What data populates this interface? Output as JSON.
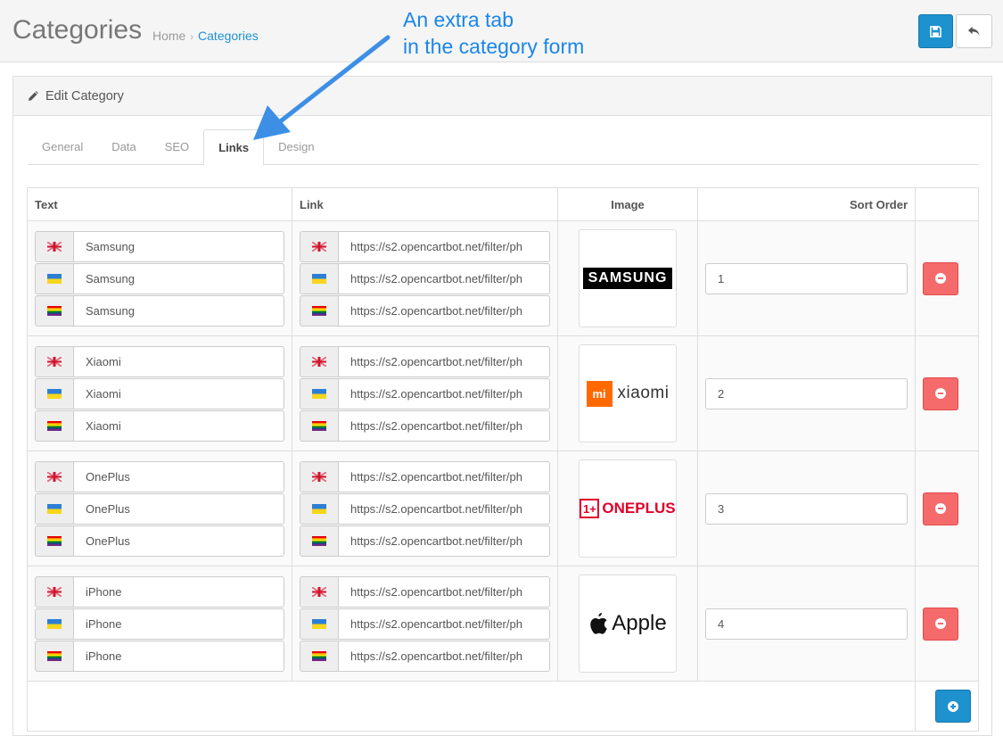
{
  "header": {
    "title": "Categories",
    "breadcrumb": [
      {
        "label": "Home"
      },
      {
        "label": "Categories"
      }
    ],
    "breadcrumb_separator": "›",
    "save_icon": "floppy-disk-icon",
    "back_icon": "reply-arrow-icon"
  },
  "annotation": {
    "text": "An extra tab\nin the category form",
    "color": "#1a86e8"
  },
  "panel": {
    "heading": "Edit Category",
    "heading_icon": "pencil-icon"
  },
  "tabs": [
    {
      "label": "General",
      "active": false
    },
    {
      "label": "Data",
      "active": false
    },
    {
      "label": "SEO",
      "active": false
    },
    {
      "label": "Links",
      "active": true
    },
    {
      "label": "Design",
      "active": false
    }
  ],
  "table": {
    "headers": {
      "text": "Text",
      "link": "Link",
      "image": "Image",
      "sort_order": "Sort Order"
    },
    "rows": [
      {
        "texts": [
          "Samsung",
          "Samsung",
          "Samsung"
        ],
        "links": [
          "https://s2.opencartbot.net/filter/ph",
          "https://s2.opencartbot.net/filter/ph",
          "https://s2.opencartbot.net/filter/ph"
        ],
        "logo_text": "SAMSUNG",
        "sort_order": "1"
      },
      {
        "texts": [
          "Xiaomi",
          "Xiaomi",
          "Xiaomi"
        ],
        "links": [
          "https://s2.opencartbot.net/filter/ph",
          "https://s2.opencartbot.net/filter/ph",
          "https://s2.opencartbot.net/filter/ph"
        ],
        "logo_mark": "mi",
        "logo_text": "xiaomi",
        "sort_order": "2"
      },
      {
        "texts": [
          "OnePlus",
          "OnePlus",
          "OnePlus"
        ],
        "links": [
          "https://s2.opencartbot.net/filter/ph",
          "https://s2.opencartbot.net/filter/ph",
          "https://s2.opencartbot.net/filter/ph"
        ],
        "logo_mark": "1+",
        "logo_text": "ONEPLUS",
        "sort_order": "3"
      },
      {
        "texts": [
          "iPhone",
          "iPhone",
          "iPhone"
        ],
        "links": [
          "https://s2.opencartbot.net/filter/ph",
          "https://s2.opencartbot.net/filter/ph",
          "https://s2.opencartbot.net/filter/ph"
        ],
        "logo_text": "Apple",
        "sort_order": "4"
      }
    ],
    "language_flags": [
      "flag-en-icon",
      "flag-ua-icon",
      "flag-rainbow-icon"
    ],
    "remove_icon": "minus-circle-icon",
    "add_icon": "plus-circle-icon"
  },
  "colors": {
    "primary": "#1e91cf",
    "danger": "#f56b6b",
    "samsung": "#000000",
    "xiaomi": "#ff6900",
    "oneplus": "#e0002a"
  }
}
